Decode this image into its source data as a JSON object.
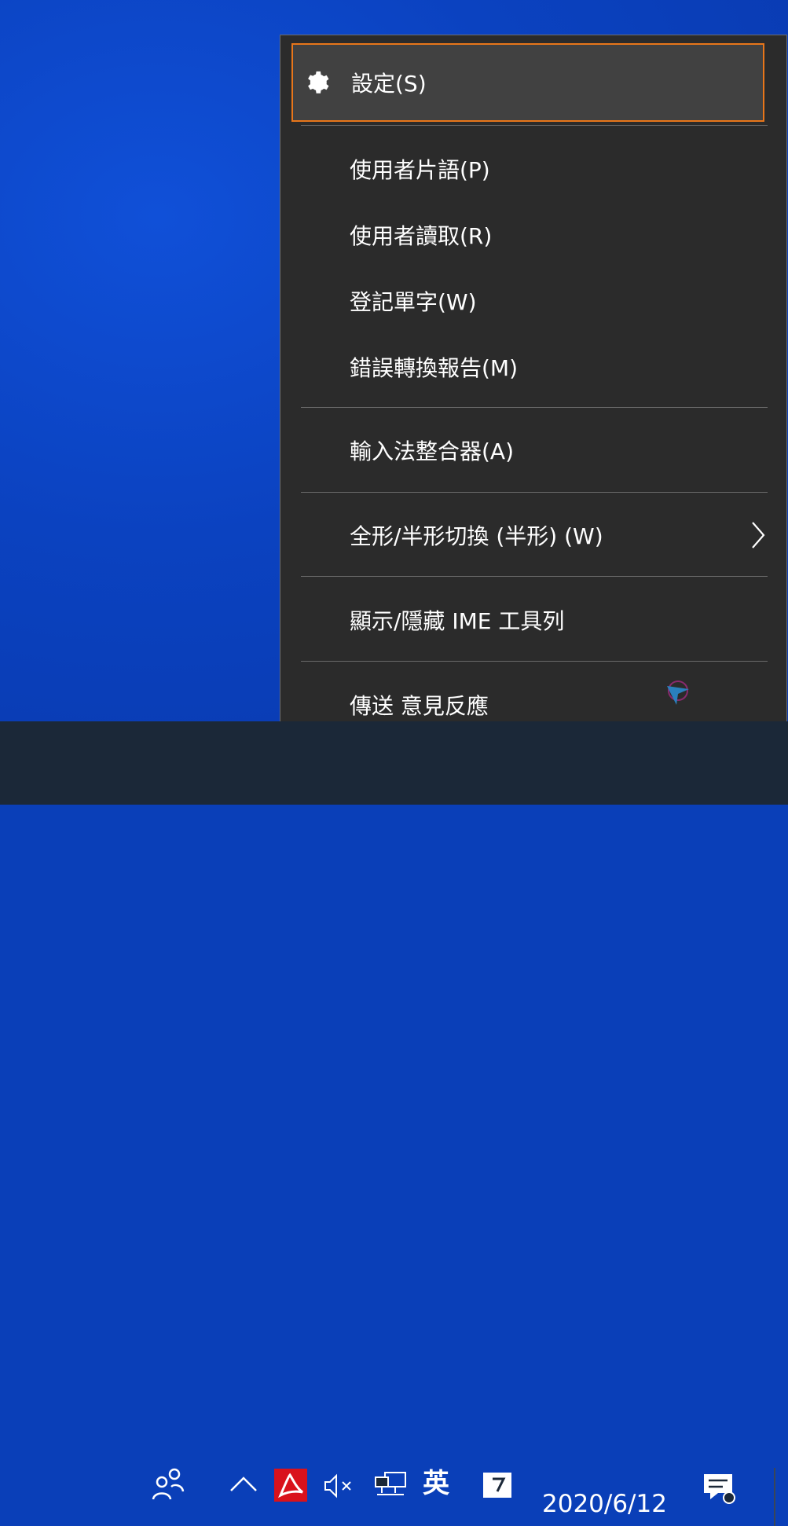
{
  "context_menu": {
    "items": [
      {
        "label": "設定(S)",
        "icon": "gear-icon"
      },
      {
        "label": "使用者片語(P)"
      },
      {
        "label": "使用者讀取(R)"
      },
      {
        "label": "登記單字(W)"
      },
      {
        "label": "錯誤轉換報告(M)"
      },
      {
        "label": "輸入法整合器(A)"
      },
      {
        "label": "全形/半形切換 (半形) (W)",
        "submenu": true
      },
      {
        "label": "顯示/隱藏 IME  工具列"
      },
      {
        "label": "傳送  意見反應"
      }
    ],
    "highlight_color": "#e8761a"
  },
  "taskbar": {
    "ime_mode": "英",
    "date": "2020/6/12",
    "icons": [
      "people-icon",
      "chevron-up-icon",
      "acrobat-icon",
      "volume-muted-icon",
      "network-icon",
      "ime-pad-icon",
      "action-center-icon"
    ]
  },
  "colors": {
    "desktop": "#0a3fb8",
    "menu_bg": "#2b2b2b",
    "taskbar": "#1b2838"
  }
}
